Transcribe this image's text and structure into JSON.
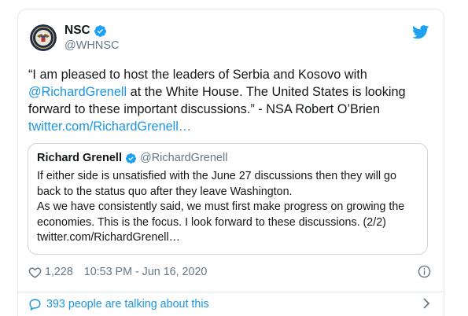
{
  "tweet": {
    "author_name": "NSC",
    "author_handle": "@WHNSC",
    "text_before": "“I am pleased to host the leaders of Serbia and Kosovo with ",
    "mention": "@RichardGrenell",
    "text_after": " at the White House. The United States is looking forward to these important discussions.” - NSA Robert O’Brien ",
    "link": "twitter.com/RichardGrenell…"
  },
  "quote": {
    "name": "Richard Grenell",
    "handle": "@RichardGrenell",
    "line1": "If either side is unsatisfied with the June 27 discussions then they will go back to the status quo after they leave Washington.",
    "line2": "As we have consistently said, we must first make progress on growing the economies. This is the focus. I look forward to these discussions. (2/2)",
    "link": "twitter.com/RichardGrenell…"
  },
  "meta": {
    "likes": "1,228",
    "timestamp": "10:53 PM - Jun 16, 2020"
  },
  "footer": {
    "talking": "393 people are talking about this"
  },
  "colors": {
    "link": "#1b95e0",
    "muted": "#657786",
    "border": "#e1e8ed"
  },
  "icons": [
    "presidential-seal-icon",
    "verified-icon",
    "twitter-bird-icon",
    "heart-icon",
    "info-icon",
    "comment-bubble-icon",
    "chevron-right-icon"
  ]
}
